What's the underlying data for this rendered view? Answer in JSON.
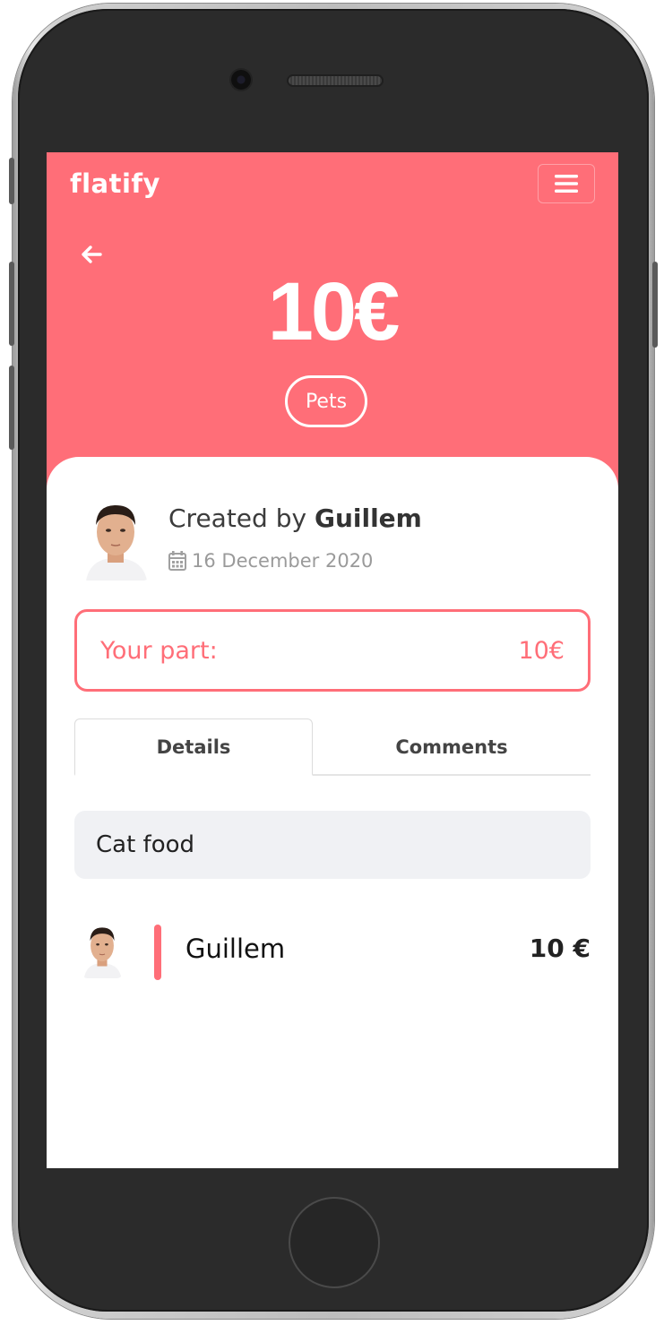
{
  "app": {
    "logo": "flatify"
  },
  "header": {
    "amount": "10€",
    "category": "Pets",
    "brand_color": "#ff6e78"
  },
  "icons": {
    "menu": "hamburger-icon",
    "back": "arrow-left-icon",
    "date": "calendar-icon"
  },
  "expense": {
    "created_prefix": "Created by",
    "created_by": "Guillem",
    "date": "16 December 2020",
    "your_part_label": "Your part:",
    "your_part_value": "10€",
    "description": "Cat food"
  },
  "tabs": [
    {
      "label": "Details",
      "active": true
    },
    {
      "label": "Comments",
      "active": false
    }
  ],
  "splits": [
    {
      "name": "Guillem",
      "amount": "10 €"
    }
  ]
}
